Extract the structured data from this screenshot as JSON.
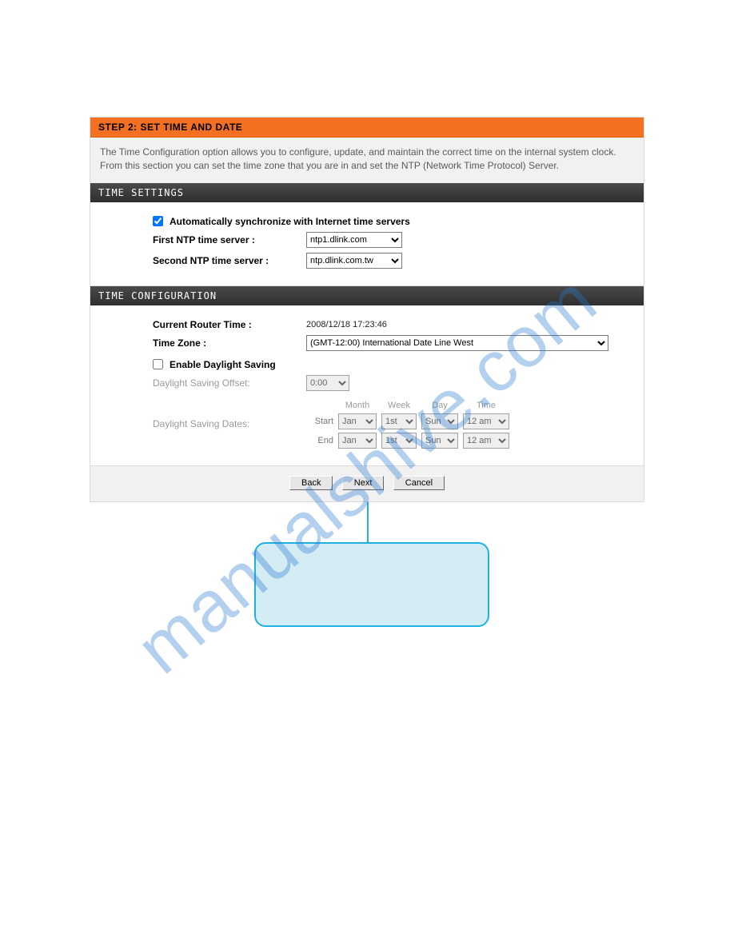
{
  "watermark_text": "manualshive.com",
  "step_header": "STEP 2: SET TIME AND DATE",
  "intro_text": "The Time Configuration option allows you to configure, update, and maintain the correct time on the internal system clock. From this section you can set the time zone that you are in and set the NTP (Network Time Protocol) Server.",
  "time_settings": {
    "title": "TIME SETTINGS",
    "auto_sync_label": "Automatically synchronize with Internet time servers",
    "auto_sync_checked": true,
    "first_ntp_label": "First NTP time server :",
    "first_ntp_value": "ntp1.dlink.com",
    "second_ntp_label": "Second NTP time server :",
    "second_ntp_value": "ntp.dlink.com.tw"
  },
  "time_config": {
    "title": "TIME CONFIGURATION",
    "current_time_label": "Current Router Time :",
    "current_time_value": "2008/12/18 17:23:46",
    "tz_label": "Time Zone :",
    "tz_value": "(GMT-12:00) International Date Line West",
    "dst_enable_label": "Enable Daylight Saving",
    "dst_enable_checked": false,
    "dst_offset_label": "Daylight Saving Offset:",
    "dst_offset_value": "0:00",
    "dst_dates_label": "Daylight Saving Dates:",
    "cols": {
      "month": "Month",
      "week": "Week",
      "day": "Day",
      "time": "Time"
    },
    "start_label": "Start",
    "end_label": "End",
    "start": {
      "month": "Jan",
      "week": "1st",
      "day": "Sun",
      "time": "12 am"
    },
    "end": {
      "month": "Jan",
      "week": "1st",
      "day": "Sun",
      "time": "12 am"
    }
  },
  "buttons": {
    "back": "Back",
    "next": "Next",
    "cancel": "Cancel"
  }
}
